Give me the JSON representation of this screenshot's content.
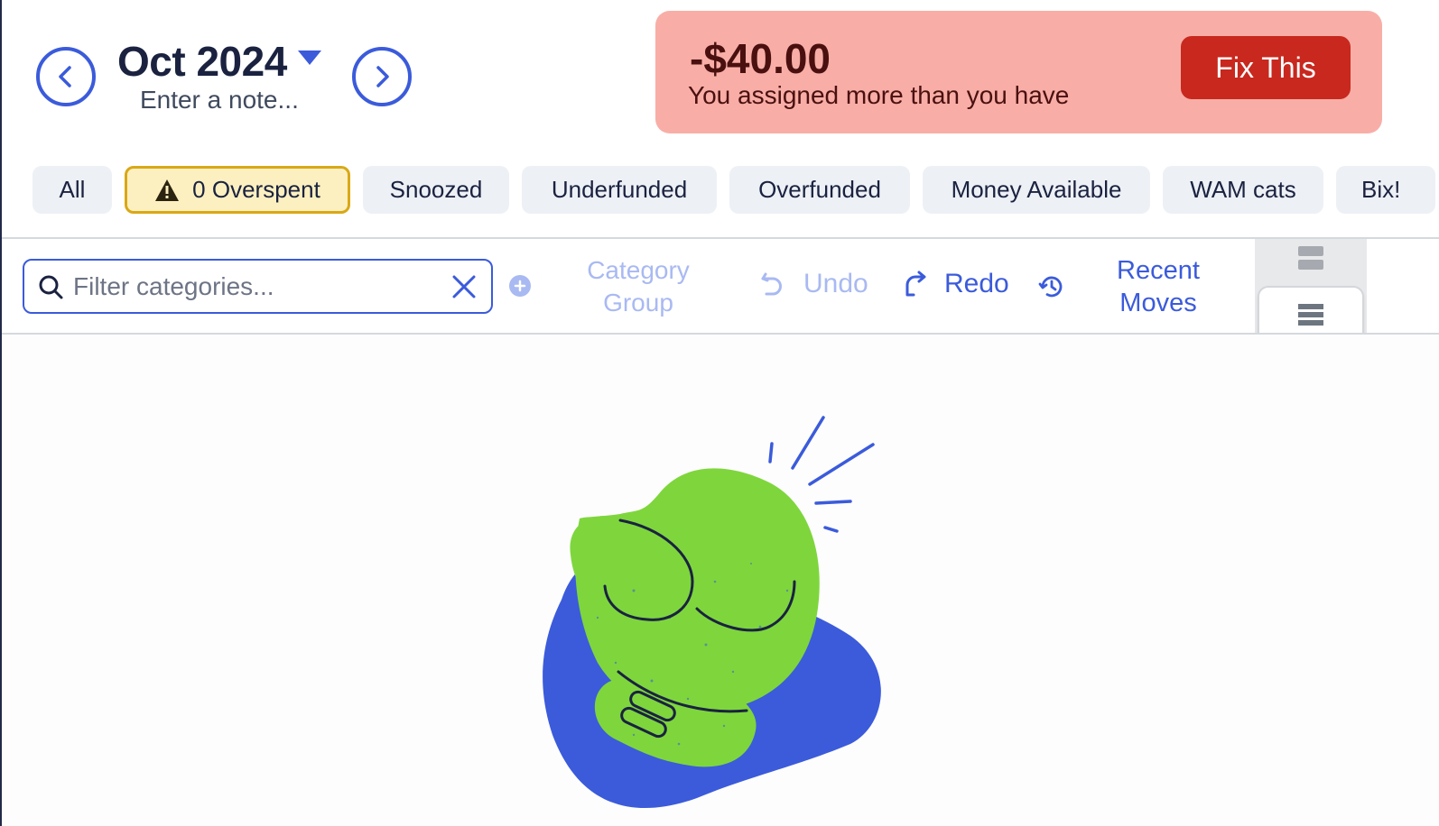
{
  "header": {
    "month": "Oct 2024",
    "note_placeholder": "Enter a note...",
    "prev_month_icon": "chevron-left-circle-icon",
    "next_month_icon": "chevron-right-circle-icon"
  },
  "alert": {
    "amount": "-$40.00",
    "message": "You assigned more than you have",
    "button_label": "Fix This",
    "colors": {
      "background": "#f8aea6",
      "button": "#c8281e",
      "text": "#4a1010"
    }
  },
  "filters": [
    {
      "label": "All"
    },
    {
      "label": "0 Overspent",
      "icon": "warning-triangle-icon",
      "selected": true
    },
    {
      "label": "Snoozed"
    },
    {
      "label": "Underfunded"
    },
    {
      "label": "Overfunded"
    },
    {
      "label": "Money Available"
    },
    {
      "label": "WAM cats"
    },
    {
      "label": "Bix!"
    }
  ],
  "toolbar": {
    "search_placeholder": "Filter categories...",
    "search_value": "",
    "category_group_label": "Category Group",
    "undo_label": "Undo",
    "redo_label": "Redo",
    "recent_moves_label": "Recent Moves"
  },
  "colors": {
    "accent": "#3b5bdb",
    "accent_disabled": "#a9b9f2",
    "chip_bg": "#edf0f5",
    "warning_bg": "#fdf0c0",
    "warning_border": "#d9a816",
    "illustration_green": "#7ed63c",
    "illustration_blue": "#3b5bdb"
  },
  "illustration": {
    "name": "boxing-glove-illustration"
  }
}
